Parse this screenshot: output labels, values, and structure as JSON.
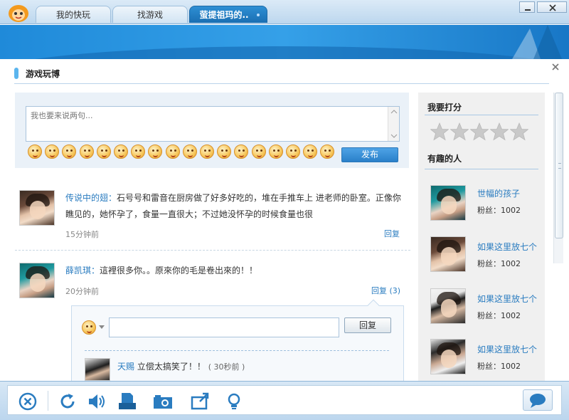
{
  "tabs": [
    {
      "label": "我的快玩"
    },
    {
      "label": "找游戏"
    },
    {
      "label": "萤提祖玛的.."
    }
  ],
  "panel": {
    "title": "游戏玩博"
  },
  "composer": {
    "placeholder": "我也要来说两句...",
    "publish_label": "发布",
    "emoji_count": 18
  },
  "posts": [
    {
      "user": "传说中的翅：",
      "text": "石号号和雷音在厨房做了好多好吃的，堆在手推车上 进老师的卧室。正像你瞧见的，她怀孕了，食量一直很大；不过她没怀孕的时候食量也很",
      "time": "15分钟前",
      "reply_label": "回复"
    },
    {
      "user": "薛凯琪：",
      "text": "這裡很多你。。原來你的毛是卷出來的！！",
      "time": "20分钟前",
      "reply_label": "回复 (3)"
    }
  ],
  "reply_box": {
    "button_label": "回复",
    "sub_user": "天赐",
    "sub_text": "立偿太搞笑了！！",
    "sub_time": "( 30秒前 )"
  },
  "sidebar": {
    "rate_title": "我要打分",
    "rating": 0,
    "rating_max": 5,
    "people_title": "有趣的人",
    "people": [
      {
        "name": "世幅的孩子",
        "fans": "粉丝：1002"
      },
      {
        "name": "如果这里放七个",
        "fans": "粉丝：1002"
      },
      {
        "name": "如果这里放七个",
        "fans": "粉丝：1002"
      },
      {
        "name": "如果这里放七个",
        "fans": "粉丝：1002"
      }
    ]
  },
  "colors": {
    "accent": "#2a7cc0",
    "banner": "#1f8ad9",
    "star_empty": "#c9c9c9"
  },
  "toolbar_icons": [
    "close-circle-icon",
    "refresh-icon",
    "volume-icon",
    "user-icon",
    "camera-icon",
    "share-icon",
    "lightbulb-icon",
    "chat-bubble-icon"
  ]
}
